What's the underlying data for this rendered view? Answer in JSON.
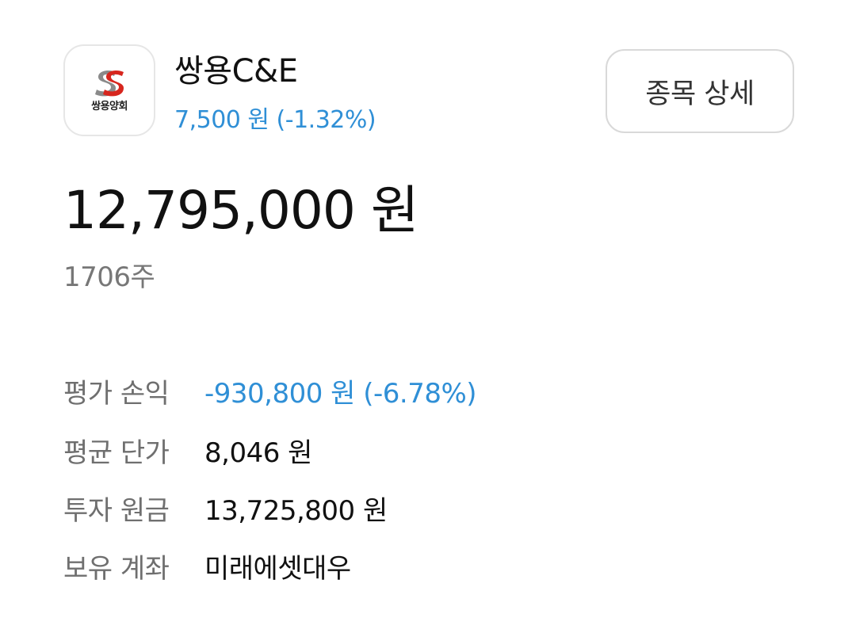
{
  "stock": {
    "logo_text": "쌍용양회",
    "logo_icon": "ssangyong-s-logo-icon",
    "name": "쌍용C&E",
    "price_change": "7,500 원 (-1.32%)",
    "detail_button_label": "종목 상세"
  },
  "holding": {
    "total_value": "12,795,000 원",
    "shares": "1706주"
  },
  "details": [
    {
      "label": "평가 손익",
      "value": "-930,800 원 (-6.78%)"
    },
    {
      "label": "평균 단가",
      "value": "8,046 원"
    },
    {
      "label": "투자 원금",
      "value": "13,725,800 원"
    },
    {
      "label": "보유 계좌",
      "value": "미래에셋대우"
    }
  ],
  "colors": {
    "loss_blue": "#2f8fd6",
    "logo_red": "#d7261e",
    "logo_gray": "#8a8a8a",
    "label_gray": "#6f6f6f"
  }
}
